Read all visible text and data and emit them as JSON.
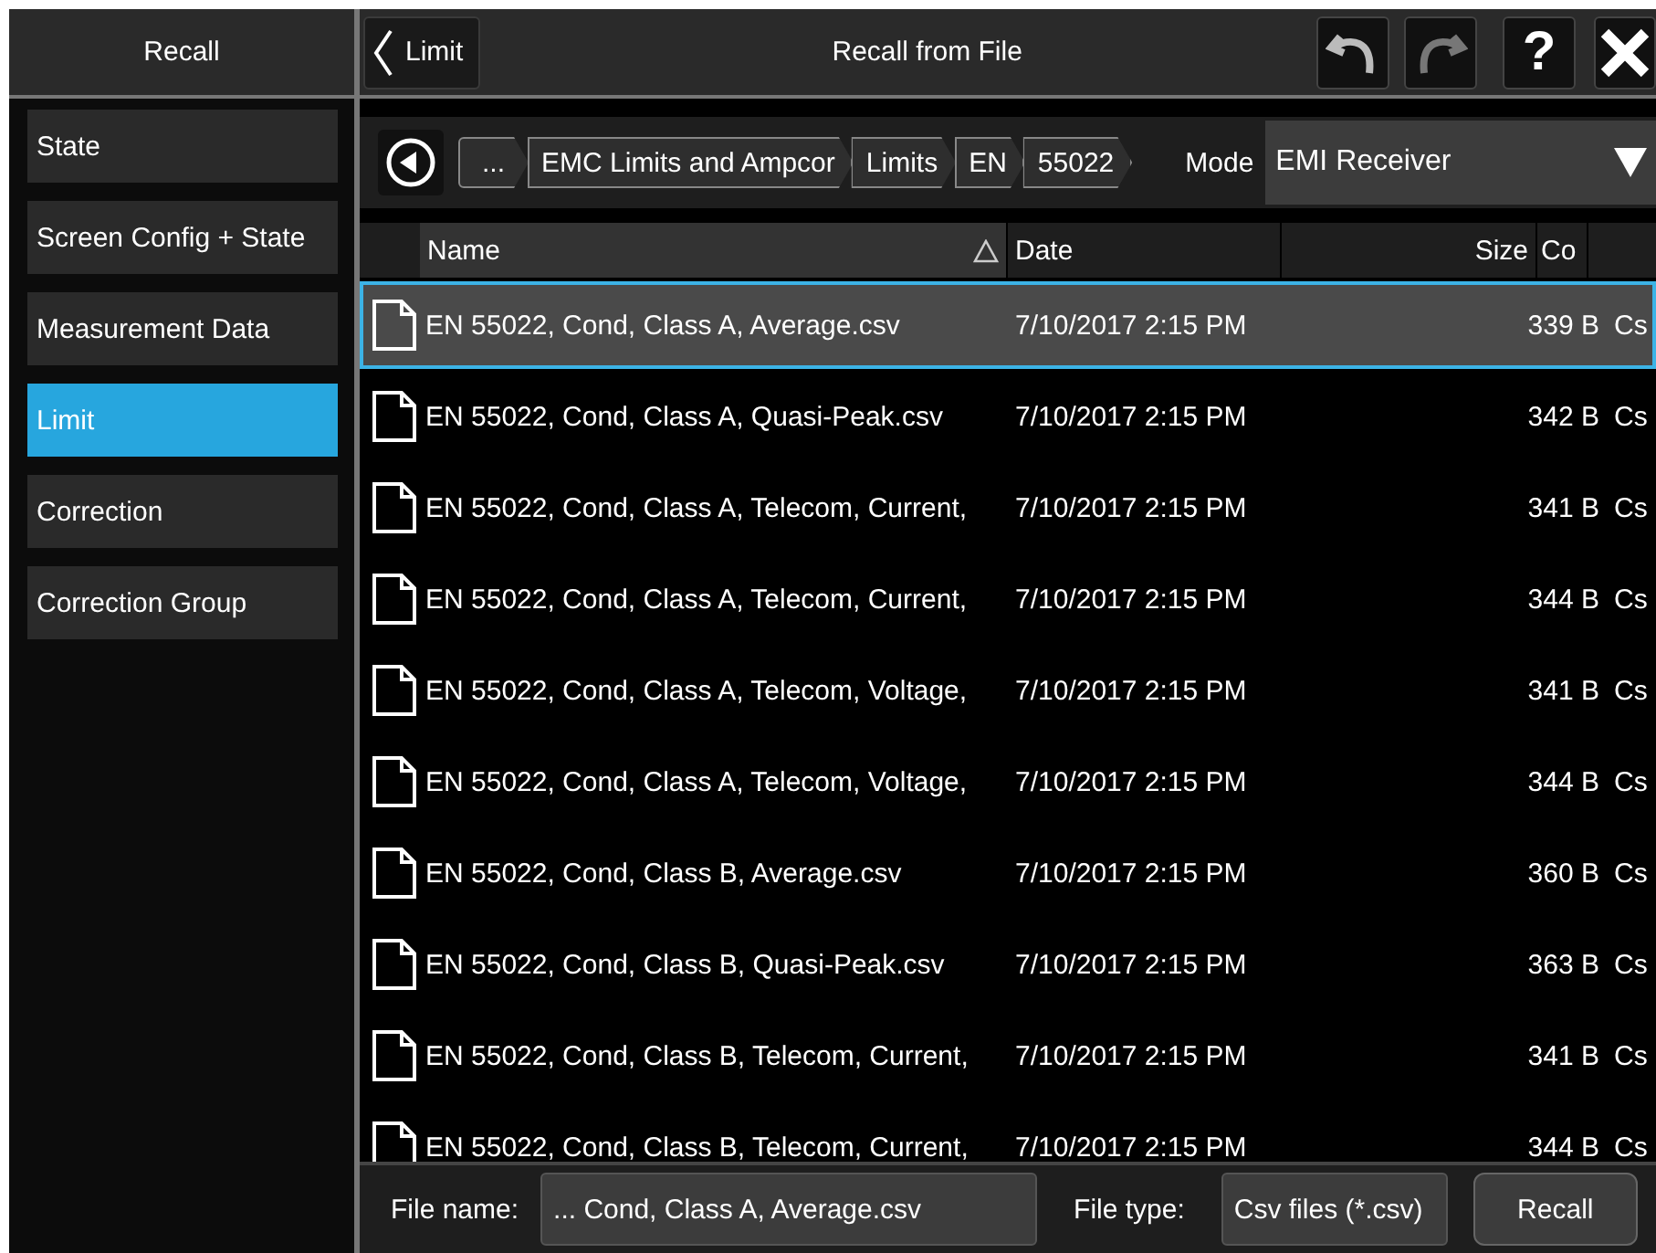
{
  "sidebar": {
    "title": "Recall",
    "items": [
      {
        "label": "State",
        "selected": false
      },
      {
        "label": "Screen Config + State",
        "selected": false
      },
      {
        "label": "Measurement Data",
        "selected": false
      },
      {
        "label": "Limit",
        "selected": true
      },
      {
        "label": "Correction",
        "selected": false
      },
      {
        "label": "Correction Group",
        "selected": false
      }
    ]
  },
  "header": {
    "back_button": "Limit",
    "title": "Recall from File",
    "help_button": "?"
  },
  "breadcrumb": [
    "...",
    "EMC Limits and Ampcor",
    "Limits",
    "EN",
    "55022"
  ],
  "mode": {
    "label": "Mode",
    "value": "EMI Receiver"
  },
  "table": {
    "columns": [
      {
        "label": "Name",
        "sorted": true
      },
      {
        "label": "Date",
        "sorted": false
      },
      {
        "label": "Size",
        "sorted": false
      },
      {
        "label": "Co",
        "sorted": false
      }
    ],
    "rows": [
      {
        "name": "EN 55022, Cond, Class A, Average.csv",
        "date": "7/10/2017 2:15 PM",
        "size": "339 B",
        "column_4": "Cs",
        "selected": true
      },
      {
        "name": "EN 55022, Cond, Class A, Quasi-Peak.csv",
        "date": "7/10/2017 2:15 PM",
        "size": "342 B",
        "column_4": "Cs",
        "selected": false
      },
      {
        "name": "EN 55022, Cond, Class A, Telecom, Current,",
        "date": "7/10/2017 2:15 PM",
        "size": "341 B",
        "column_4": "Cs",
        "selected": false
      },
      {
        "name": "EN 55022, Cond, Class A, Telecom, Current,",
        "date": "7/10/2017 2:15 PM",
        "size": "344 B",
        "column_4": "Cs",
        "selected": false
      },
      {
        "name": "EN 55022, Cond, Class A, Telecom, Voltage,",
        "date": "7/10/2017 2:15 PM",
        "size": "341 B",
        "column_4": "Cs",
        "selected": false
      },
      {
        "name": "EN 55022, Cond, Class A, Telecom, Voltage,",
        "date": "7/10/2017 2:15 PM",
        "size": "344 B",
        "column_4": "Cs",
        "selected": false
      },
      {
        "name": "EN 55022, Cond, Class B, Average.csv",
        "date": "7/10/2017 2:15 PM",
        "size": "360 B",
        "column_4": "Cs",
        "selected": false
      },
      {
        "name": "EN 55022, Cond, Class B, Quasi-Peak.csv",
        "date": "7/10/2017 2:15 PM",
        "size": "363 B",
        "column_4": "Cs",
        "selected": false
      },
      {
        "name": "EN 55022, Cond, Class B, Telecom, Current,",
        "date": "7/10/2017 2:15 PM",
        "size": "341 B",
        "column_4": "Cs",
        "selected": false
      },
      {
        "name": "EN 55022, Cond, Class B, Telecom, Current,",
        "date": "7/10/2017 2:15 PM",
        "size": "344 B",
        "column_4": "Cs",
        "selected": false
      }
    ]
  },
  "footer": {
    "file_name_label": "File name:",
    "file_name": "... Cond, Class A, Average.csv",
    "file_type_label": "File type:",
    "file_type": "Csv files (*.csv)",
    "recall_button": "Recall"
  }
}
